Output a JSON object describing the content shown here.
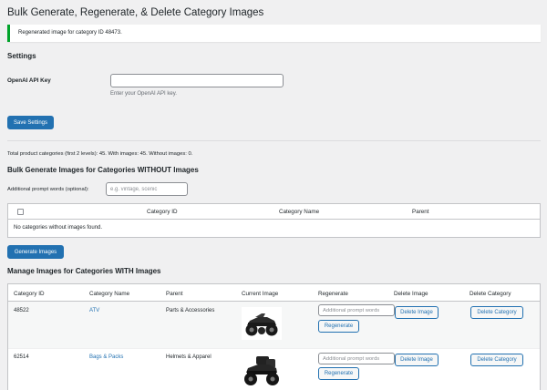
{
  "page": {
    "title": "Bulk Generate, Regenerate, & Delete Category Images",
    "notice": "Regenerated image for category ID 48473."
  },
  "settings": {
    "heading": "Settings",
    "api_key_label": "OpenAI API Key",
    "api_key_value": "",
    "api_key_description": "Enter your OpenAI API key.",
    "save_button": "Save Settings"
  },
  "summary": "Total product categories (first 2 levels): 45. With images: 45. Without images: 0.",
  "without_images": {
    "heading": "Bulk Generate Images for Categories WITHOUT Images",
    "prompt_label": "Additional prompt words (optional):",
    "prompt_placeholder": "e.g. vintage, scenic",
    "columns": [
      "Category ID",
      "Category Name",
      "Parent"
    ],
    "empty_message": "No categories without images found.",
    "generate_button": "Generate Images"
  },
  "with_images": {
    "heading": "Manage Images for Categories WITH Images",
    "columns": [
      "Category ID",
      "Category Name",
      "Parent",
      "Current Image",
      "Regenerate",
      "Delete Image",
      "Delete Category"
    ],
    "rows": [
      {
        "id": "48522",
        "name": "ATV",
        "parent": "Parts & Accessories",
        "image": "atv-photo",
        "prompt_placeholder": "Additional prompt words",
        "regenerate": "Regenerate",
        "delete_image": "Delete Image",
        "delete_category": "Delete Category"
      },
      {
        "id": "62514",
        "name": "Bags & Packs",
        "parent": "Helmets & Apparel",
        "image": "atv-with-bags-photo",
        "prompt_placeholder": "Additional prompt words",
        "regenerate": "Regenerate",
        "delete_image": "Delete Image",
        "delete_category": "Delete Category"
      }
    ]
  },
  "colors": {
    "primary": "#2271b1",
    "notice_success": "#00a32a",
    "background": "#f0f0f1"
  }
}
